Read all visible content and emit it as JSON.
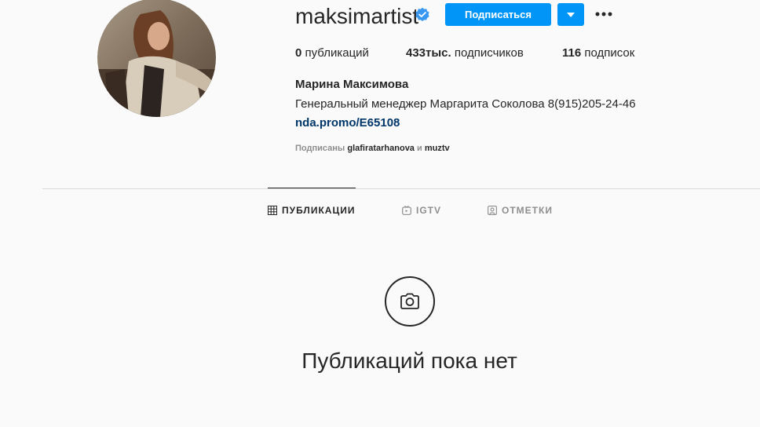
{
  "profile": {
    "username": "maksimartist",
    "verified_icon": "verified-badge-icon",
    "follow_label": "Подписаться",
    "dropdown_icon": "caret-down-icon",
    "more_icon": "more-options-icon",
    "full_name": "Марина Максимова",
    "bio": "Генеральный менеджер Маргарита Соколова 8(915)205-24-46",
    "link": "nda.promo/E65108",
    "accent_color": "#0095f6"
  },
  "stats": {
    "posts_count": "0",
    "posts_label": "публикаций",
    "followers_count": "433тыс.",
    "followers_label": "подписчиков",
    "following_count": "116",
    "following_label": "подписок"
  },
  "followed_by": {
    "prefix": "Подписаны",
    "account_1": "glafiratarhanova",
    "joiner": "и",
    "account_2": "muztv"
  },
  "tabs": [
    {
      "label": "ПУБЛИКАЦИИ",
      "icon": "grid-icon",
      "active": true
    },
    {
      "label": "IGTV",
      "icon": "igtv-icon",
      "active": false
    },
    {
      "label": "ОТМЕТКИ",
      "icon": "tagged-icon",
      "active": false
    }
  ],
  "empty_state": {
    "icon": "camera-icon",
    "message": "Публикаций пока нет"
  }
}
